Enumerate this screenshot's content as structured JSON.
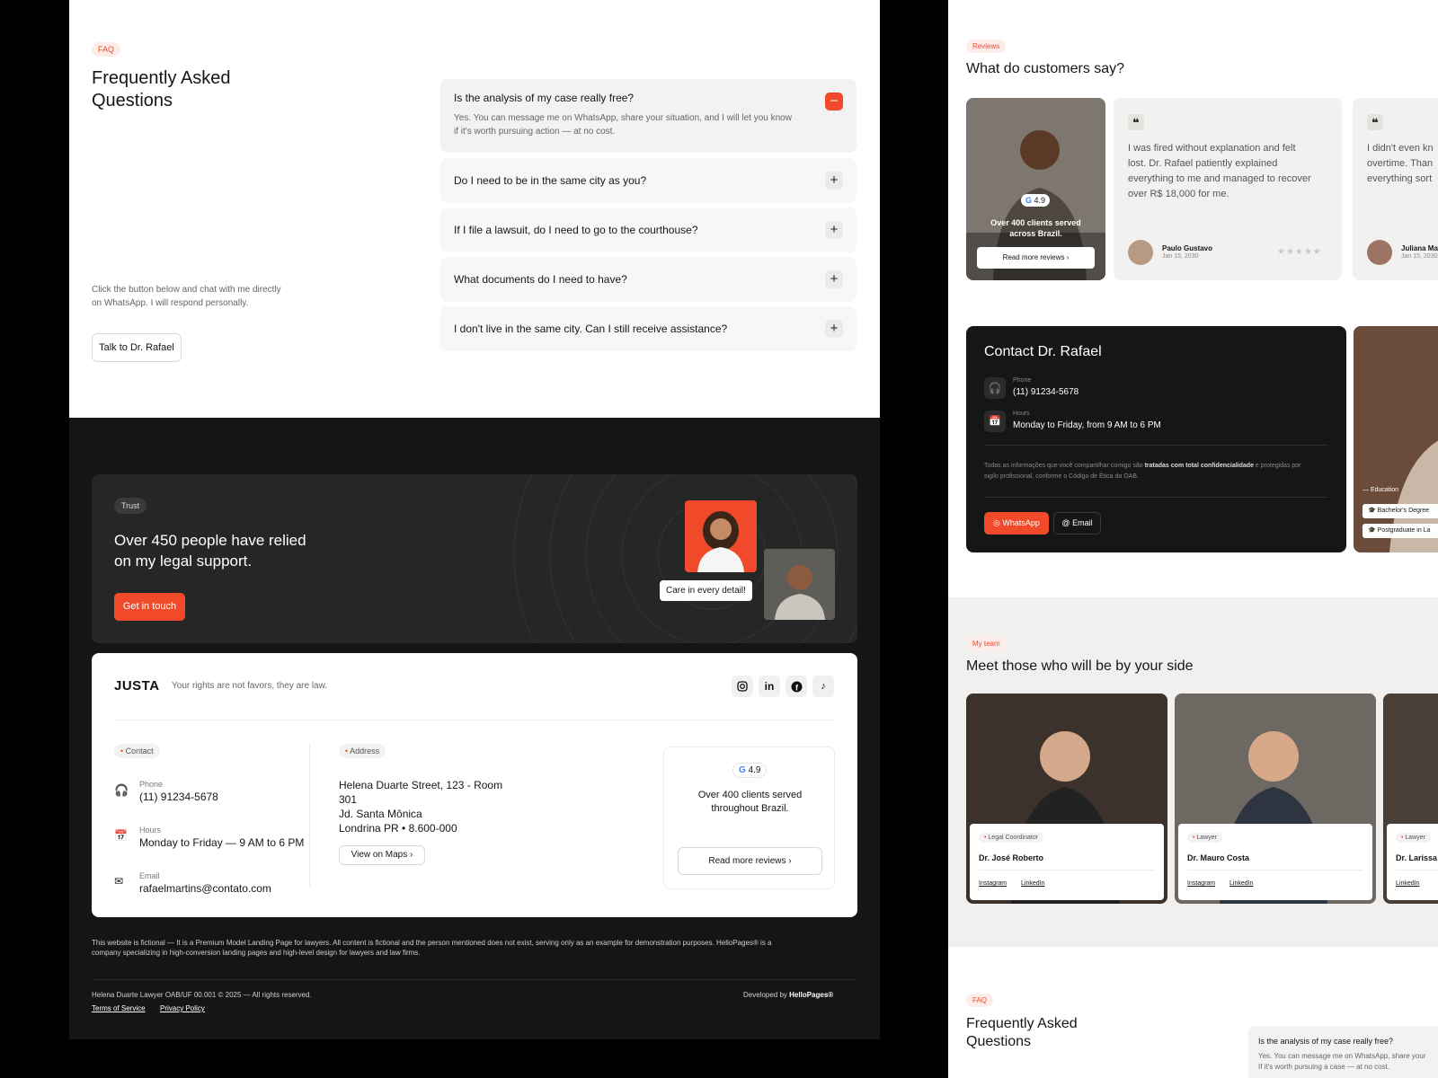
{
  "faq": {
    "badge": "FAQ",
    "title_line1": "Frequently Asked",
    "title_line2": "Questions",
    "side_text_line1": "Click the button below and chat with me directly",
    "side_text_line2": "on WhatsApp. I will respond personally.",
    "cta": "Talk to Dr. Rafael",
    "items": [
      {
        "q": "Is the analysis of my case really free?",
        "a_line1": "Yes. You can message me on WhatsApp, share your situation, and I will let you know",
        "a_line2": "if it's worth pursuing action — at no cost."
      },
      {
        "q": "Do I need to be in the same city as you?"
      },
      {
        "q": "If I file a lawsuit, do I need to go to the courthouse?"
      },
      {
        "q": "What documents do I need to have?"
      },
      {
        "q": "I don't live in the same city. Can I still receive assistance?"
      }
    ]
  },
  "trust": {
    "badge": "Trust",
    "title_line1": "Over 450 people have relied",
    "title_line2": "on my legal support.",
    "cta": "Get in touch",
    "bubble": "Care in every detail!"
  },
  "footer": {
    "logo": "JUSTA",
    "tagline": "Your rights are not favors, they are law.",
    "contact_badge": "Contact",
    "phone_label": "Phone",
    "phone": "(11) 91234-5678",
    "hours_label": "Hours",
    "hours": "Monday to Friday — 9 AM to 6 PM",
    "email_label": "Email",
    "email": "rafaelmartins@contato.com",
    "address_badge": "Address",
    "address_line1": "Helena Duarte Street, 123 - Room",
    "address_line2": "301",
    "address_line3": "Jd. Santa Mônica",
    "address_line4": "Londrina PR • 8.600-000",
    "maps_button": "View on Maps",
    "rating": "4.9",
    "reviews_text_line1": "Over 400 clients served",
    "reviews_text_line2": "throughout Brazil.",
    "reviews_button": "Read more reviews",
    "disclaimer_line1": "This website is fictional — It is a Premium Model Landing Page for lawyers. All content is fictional and the person mentioned does not exist, serving only as an example for demonstration purposes. HelloPages® is a",
    "disclaimer_line2": "company specializing in high-conversion landing pages and high-level design for lawyers and law firms.",
    "copyright": "Helena Duarte Lawyer OAB/UF 00.001 © 2025 — All rights reserved.",
    "terms": "Terms of Service",
    "privacy": "Privacy Policy",
    "developed_by": "Developed by",
    "brand": "HelloPages®"
  },
  "reviews": {
    "badge": "Reviews",
    "title": "What do customers say?",
    "photo_rating": "4.9",
    "photo_text_line1": "Over 400 clients served",
    "photo_text_line2": "across Brazil.",
    "photo_button": "Read more reviews",
    "items": [
      {
        "text_line1": "I was fired without explanation and felt",
        "text_line2": "lost. Dr. Rafael patiently explained",
        "text_line3": "everything to me and managed to recover",
        "text_line4": "over R$ 18,000 for me.",
        "name": "Paulo Gustavo",
        "date": "Jan 15, 2030"
      },
      {
        "text_line1": "I didn't even kn",
        "text_line2": "overtime. Than",
        "text_line3": "everything sort",
        "name": "Juliana Ma",
        "date": "Jan 15, 2030"
      }
    ]
  },
  "contact": {
    "title": "Contact Dr. Rafael",
    "phone_label": "Phone",
    "phone": "(11) 91234-5678",
    "hours_label": "Hours",
    "hours": "Monday to Friday, from 9 AM to 6 PM",
    "note_line1_a": "Todas as informações que você compartilhar comigo são ",
    "note_line1_b": "tratadas com total confidencialidade",
    "note_line1_c": " e protegidas por",
    "note_line2": "sigilo profissional, conforme o Código de Ética da OAB.",
    "whatsapp": "WhatsApp",
    "email": "Email",
    "education_label": "— Education",
    "edu1": "Bachelor's Degree",
    "edu2": "Postgraduate in La"
  },
  "team": {
    "badge": "My team",
    "title": "Meet those who will be by your side",
    "members": [
      {
        "role": "Legal Coordinator",
        "name": "Dr. José Roberto",
        "link1": "Instagram",
        "link2": "LinkedIn"
      },
      {
        "role": "Lawyer",
        "name": "Dr. Mauro Costa",
        "link1": "Instagram",
        "link2": "LinkedIn"
      },
      {
        "role": "Lawyer",
        "name": "Dr. Larissa",
        "link1": "LinkedIn"
      }
    ]
  },
  "faq2": {
    "badge": "FAQ",
    "title_line1": "Frequently Asked",
    "title_line2": "Questions",
    "q": "Is the analysis of my case really free?",
    "a_line1": "Yes. You can message me on WhatsApp, share your",
    "a_line2": "If it's worth pursuing a case — at no cost."
  },
  "colors": {
    "accent": "#f04a2a",
    "dark": "#151515",
    "panel": "#262626"
  }
}
